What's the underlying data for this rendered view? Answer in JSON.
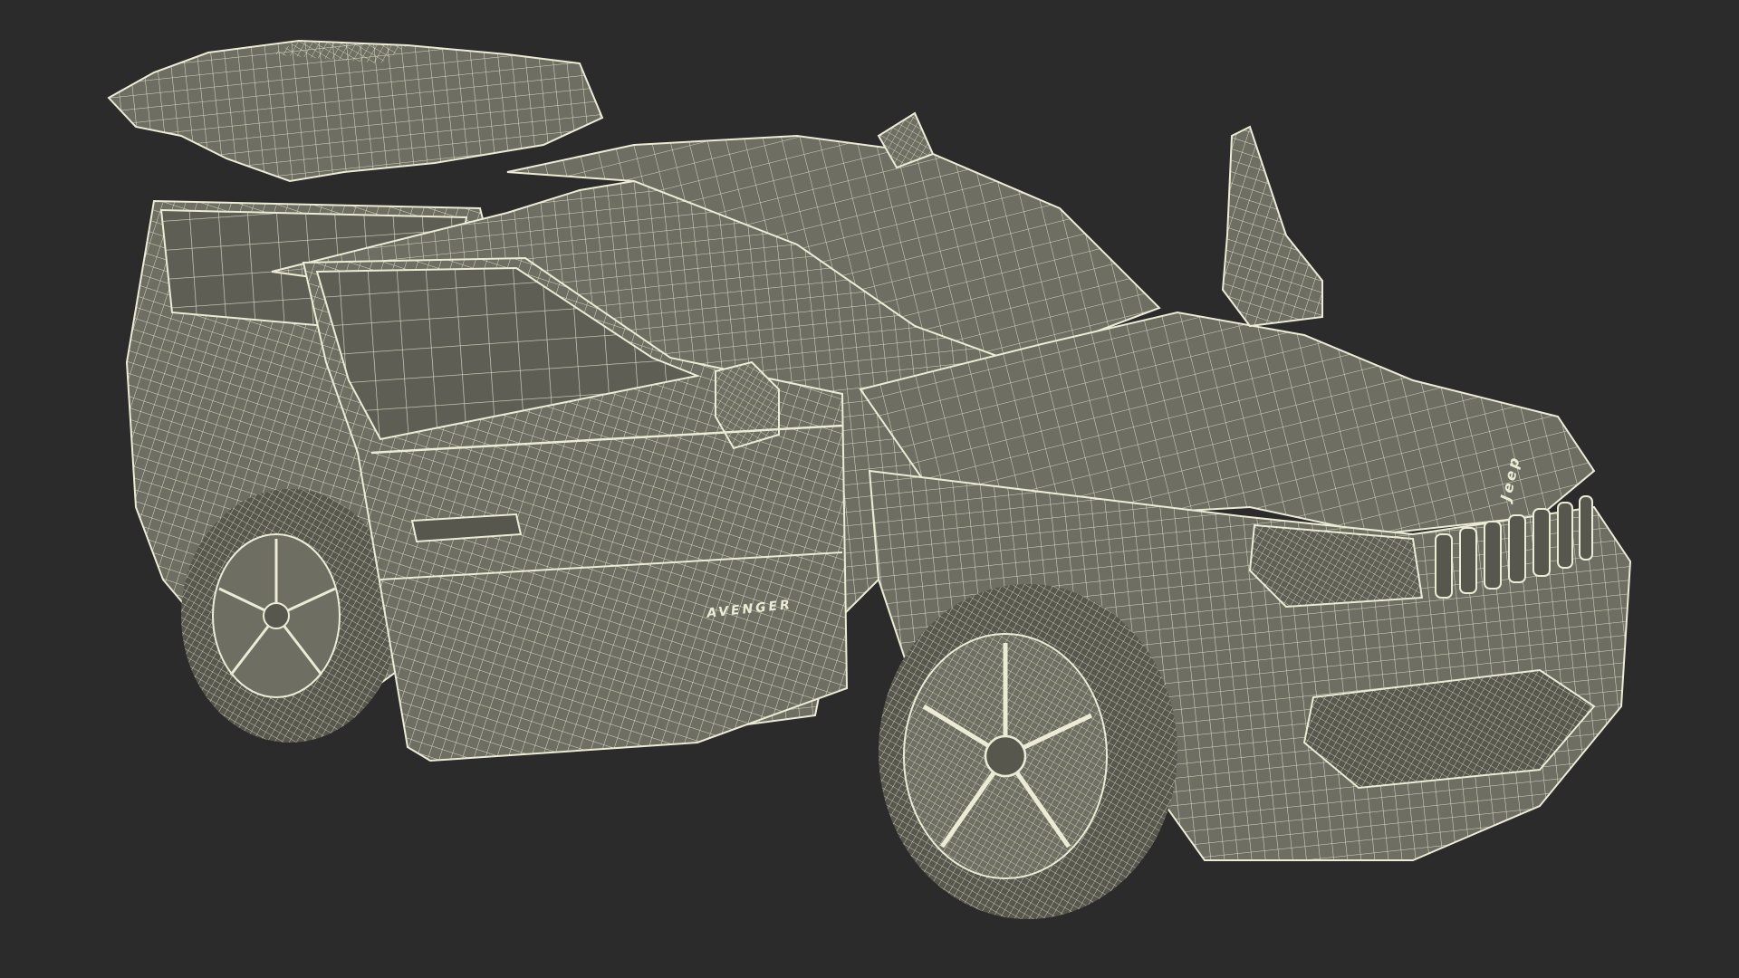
{
  "scene": {
    "background_color": "#2b2b2b",
    "surface_color": "#6e6e62",
    "surface_shadow_color": "#57574d",
    "wire_color": "#ecebd6",
    "glass_color": "#5e5e54"
  },
  "vehicle": {
    "badge_text": "AVENGER",
    "grille_emblem_text": "Jeep"
  }
}
